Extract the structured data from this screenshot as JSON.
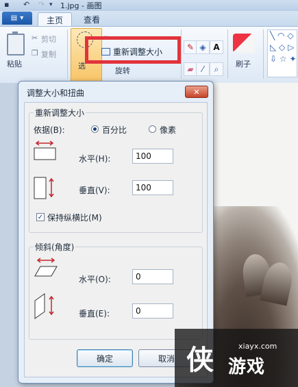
{
  "window": {
    "title": "1.jpg - 画图"
  },
  "quick_access": {
    "save_icon": "save-icon",
    "undo_icon": "undo-icon",
    "redo_icon": "redo-icon"
  },
  "ribbon": {
    "file_tab_icon": "paint-menu-icon",
    "tabs": [
      {
        "label": "主页",
        "active": true
      },
      {
        "label": "查看",
        "active": false
      }
    ],
    "clipboard": {
      "paste": "粘贴",
      "cut": "剪切",
      "copy": "复制"
    },
    "image": {
      "select": "选",
      "resize": "重新调整大小",
      "rotate": "旋转"
    },
    "brushes": "刷子"
  },
  "dialog": {
    "title": "调整大小和扭曲",
    "close": "✕",
    "resize_group": {
      "title": "重新调整大小",
      "by_label": "依据(B):",
      "options": [
        {
          "label": "百分比",
          "checked": true
        },
        {
          "label": "像素",
          "checked": false
        }
      ],
      "horizontal_label": "水平(H):",
      "horizontal_value": "100",
      "vertical_label": "垂直(V):",
      "vertical_value": "100",
      "maintain_ratio": {
        "label": "保持纵横比(M)",
        "checked": true
      }
    },
    "skew_group": {
      "title": "倾斜(角度)",
      "horizontal_label": "水平(O):",
      "horizontal_value": "0",
      "vertical_label": "垂直(E):",
      "vertical_value": "0"
    },
    "ok": "确定",
    "cancel": "取消"
  },
  "watermark": {
    "logo": "侠",
    "name": "游戏",
    "url": "xiayx.com"
  },
  "colors": {
    "highlight": "#e2333c",
    "ribbon_select": "#f8c465"
  }
}
